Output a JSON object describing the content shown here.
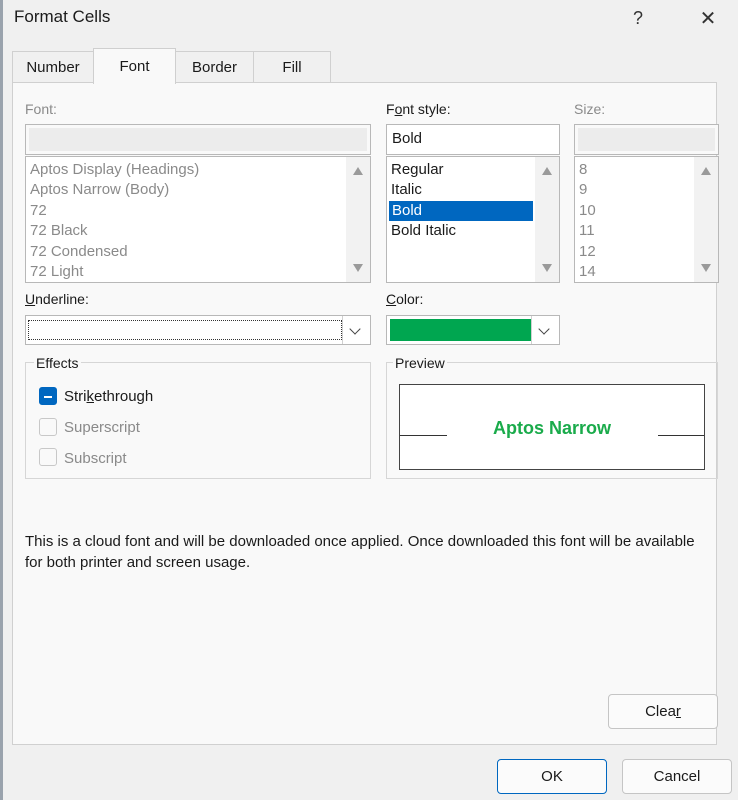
{
  "dialog": {
    "title": "Format Cells",
    "help_label": "?",
    "close_label": "✕"
  },
  "tabs": [
    {
      "label": "Number"
    },
    {
      "label": "Font"
    },
    {
      "label": "Border"
    },
    {
      "label": "Fill"
    }
  ],
  "font": {
    "label": "Font:",
    "value": "",
    "items": [
      "Aptos Display (Headings)",
      "Aptos Narrow (Body)",
      "72",
      "72 Black",
      "72 Condensed",
      "72 Light"
    ]
  },
  "font_style": {
    "label": "Font style:",
    "value": "Bold",
    "items": [
      "Regular",
      "Italic",
      "Bold",
      "Bold Italic"
    ],
    "selected": "Bold"
  },
  "size": {
    "label": "Size:",
    "value": "",
    "items": [
      "8",
      "9",
      "10",
      "11",
      "12",
      "14"
    ]
  },
  "underline": {
    "label": "Underline:",
    "value": ""
  },
  "color": {
    "label": "Color:",
    "swatch": "#00a650"
  },
  "effects": {
    "label": "Effects",
    "strikethrough": "Strikethrough",
    "superscript": "Superscript",
    "subscript": "Subscript"
  },
  "preview": {
    "label": "Preview",
    "sample": "Aptos Narrow",
    "color": "#1aab4b"
  },
  "info_text": "This is a cloud font and will be downloaded once applied. Once downloaded this font will be available for both printer and screen usage.",
  "buttons": {
    "clear": "Clear",
    "ok": "OK",
    "cancel": "Cancel"
  },
  "accent": "#0067c0"
}
